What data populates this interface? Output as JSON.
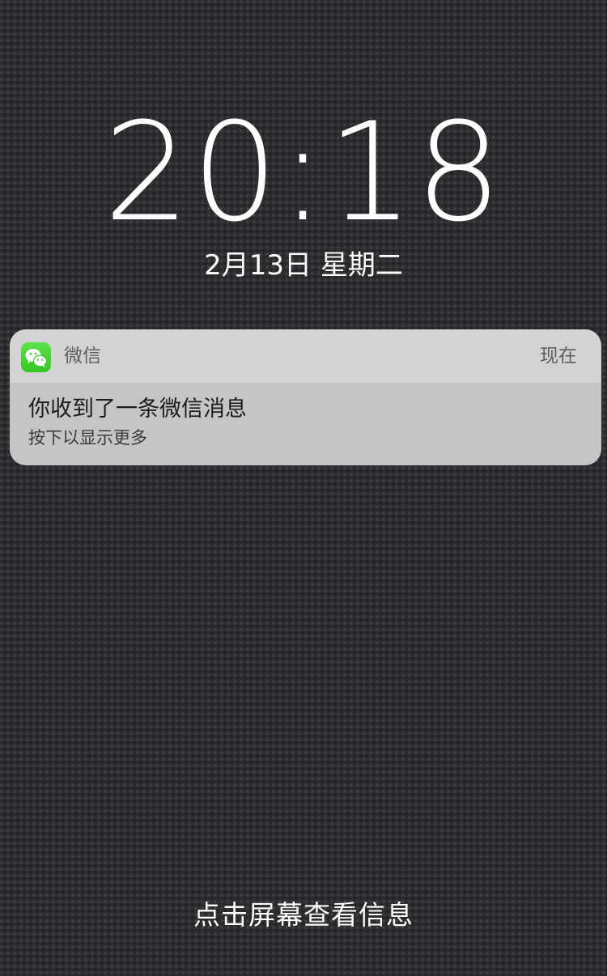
{
  "lockscreen": {
    "time": "20:18",
    "date": "2月13日 星期二",
    "hint": "点击屏幕查看信息"
  },
  "notification": {
    "app_name": "微信",
    "app_icon": "wechat-icon",
    "time": "现在",
    "title": "你收到了一条微信消息",
    "body": "按下以显示更多",
    "accent_color": "#3fd12d"
  }
}
